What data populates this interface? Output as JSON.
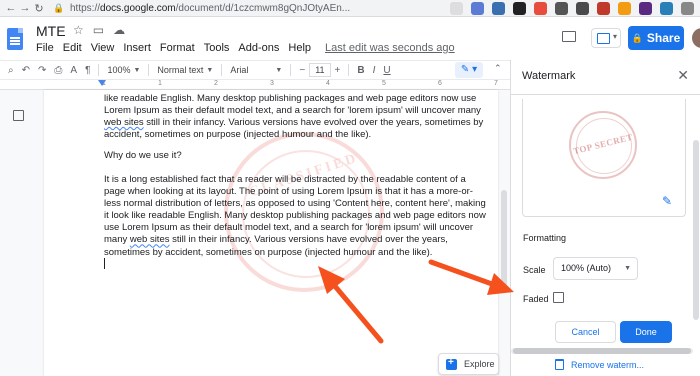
{
  "browser": {
    "url_prefix": "https://",
    "url_host": "docs.google.com",
    "url_path": "/document/d/1czcmwm8gQnJOtyAEn..."
  },
  "header": {
    "doc_title": "MTE",
    "menu": [
      "File",
      "Edit",
      "View",
      "Insert",
      "Format",
      "Tools",
      "Add-ons",
      "Help"
    ],
    "last_edit": "Last edit was seconds ago",
    "share_label": "Share"
  },
  "toolbar": {
    "zoom": "100%",
    "style": "Normal text",
    "font": "Arial",
    "font_size": "11"
  },
  "ruler": {
    "ticks": [
      "1",
      "",
      "1",
      "",
      "2",
      "",
      "3",
      "",
      "4",
      "",
      "5",
      "",
      "6",
      "",
      "7"
    ]
  },
  "document": {
    "para1_a": "like readable English. Many desktop publishing packages and web page editors now use Lorem Ipsum as their default model text, and a search for 'lorem ipsum' will uncover many ",
    "para1_link": "web sites",
    "para1_b": " still in their infancy. Various versions have evolved over the years, sometimes by accident, sometimes on purpose (injected humour and the like).",
    "para2": "Why do we use it?",
    "para3_a": "It is a long established fact that a reader will be distracted by the readable content of a page when looking at its layout. The point of using Lorem Ipsum is that it has a more-or-less normal distribution of letters, as opposed to using 'Content here, content here', making it look like readable English. Many desktop publishing packages and web page editors now use Lorem Ipsum as their default model text, and a search for 'lorem ipsum' will uncover many ",
    "para3_link": "web sites",
    "para3_b": " still in their infancy. Various versions have evolved over the years, sometimes by accident, sometimes on purpose (injected humour and the like).",
    "watermark_text": "CLASSIFIED"
  },
  "explore": {
    "label": "Explore"
  },
  "watermark_panel": {
    "title": "Watermark",
    "preview_text": "TOP SECRET",
    "formatting_heading": "Formatting",
    "scale_label": "Scale",
    "scale_value": "100% (Auto)",
    "faded_label": "Faded",
    "faded_checked": false,
    "cancel_label": "Cancel",
    "done_label": "Done",
    "remove_label": "Remove waterm..."
  },
  "colors": {
    "accent": "#1a73e8",
    "annotation_arrow": "#f4511e",
    "stamp_red": "#d93025"
  }
}
